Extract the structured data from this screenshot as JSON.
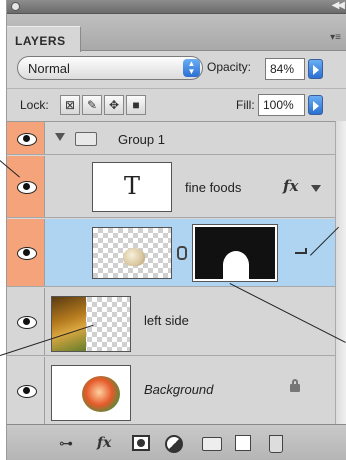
{
  "panel": {
    "tab_label": "LAYERS",
    "blend_mode": "Normal",
    "opacity_label": "Opacity:",
    "opacity_value": "84%",
    "lock_label": "Lock:",
    "fill_label": "Fill:",
    "fill_value": "100%"
  },
  "layers": [
    {
      "name": "Group 1",
      "kind": "group",
      "expanded": true,
      "visible": true,
      "eye_highlight": true
    },
    {
      "name": "fine foods",
      "kind": "text",
      "thumb_glyph": "T",
      "effects": "fx",
      "visible": true,
      "eye_highlight": true
    },
    {
      "name": "",
      "kind": "masked-image",
      "selected": true,
      "visible": true,
      "eye_highlight": true
    },
    {
      "name": "left side",
      "kind": "image",
      "visible": true,
      "eye_highlight": false
    },
    {
      "name": "Background",
      "kind": "background",
      "locked": true,
      "visible": true,
      "eye_highlight": false
    }
  ],
  "colors": {
    "eye_highlight": "#f4a37a",
    "selected_row": "#aed4f2",
    "panel_bg": "#d6d6d6"
  },
  "icons": {
    "lock_buttons": [
      "lock-transparent-pixels-icon",
      "lock-image-pixels-icon",
      "lock-position-icon",
      "lock-all-icon"
    ],
    "bottom_bar": [
      "link-layers-icon",
      "add-layer-style-icon",
      "add-mask-icon",
      "new-adjustment-layer-icon",
      "new-group-icon",
      "new-layer-icon",
      "delete-layer-icon"
    ]
  }
}
